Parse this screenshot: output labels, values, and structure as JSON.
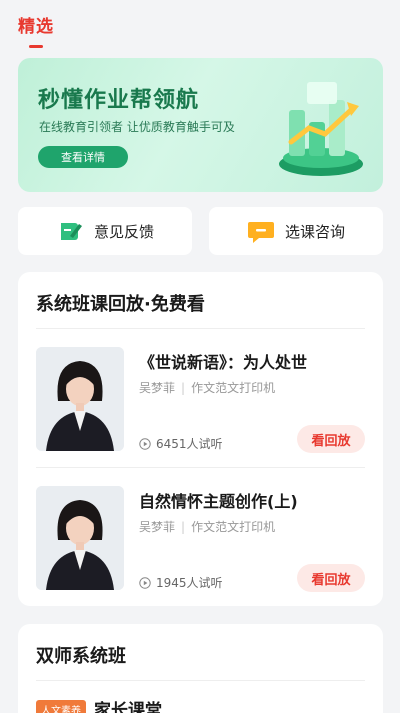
{
  "top_tab": {
    "label": "精选"
  },
  "banner": {
    "title": "秒懂作业帮领航",
    "subtitle": "在线教育引领者  让优质教育触手可及",
    "button_label": "查看详情",
    "accent": "#1fa46c"
  },
  "quick_actions": [
    {
      "label": "意见反馈",
      "icon": "feedback-pencil-icon"
    },
    {
      "label": "选课咨询",
      "icon": "chat-bubble-icon"
    }
  ],
  "section1": {
    "title": "系统班课回放·免费看",
    "courses": [
      {
        "title": "《世说新语》：为人处世",
        "teacher": "吴梦菲",
        "category": "作文范文打印机",
        "listeners": "6451人试听",
        "button": "看回放"
      },
      {
        "title": "自然情怀主题创作(上)",
        "teacher": "吴梦菲",
        "category": "作文范文打印机",
        "listeners": "1945人试听",
        "button": "看回放"
      }
    ]
  },
  "section2": {
    "title": "双师系统班",
    "tag": "人文素养",
    "item_title": "家长课堂"
  }
}
